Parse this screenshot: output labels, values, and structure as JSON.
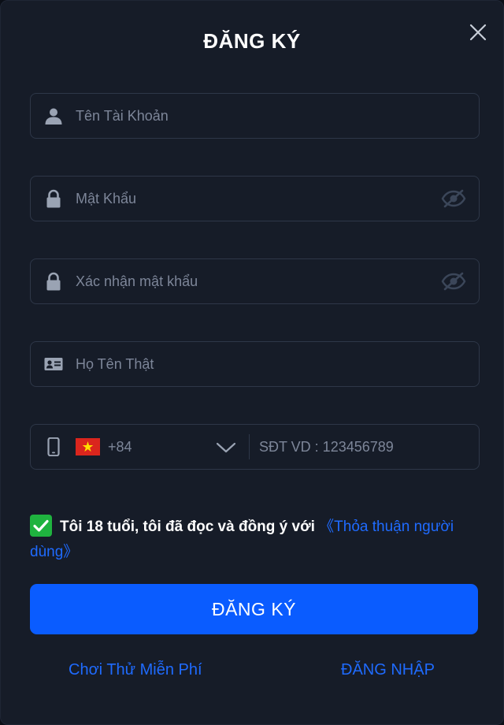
{
  "modal": {
    "title": "ĐĂNG KÝ"
  },
  "form": {
    "username": {
      "placeholder": "Tên Tài Khoản",
      "value": ""
    },
    "password": {
      "placeholder": "Mật Khẩu",
      "value": ""
    },
    "confirm_password": {
      "placeholder": "Xác nhận mật khẩu",
      "value": ""
    },
    "real_name": {
      "placeholder": "Họ Tên Thật",
      "value": ""
    },
    "phone": {
      "country_code": "+84",
      "placeholder": "SĐT VD : 123456789",
      "value": ""
    }
  },
  "agreement": {
    "checked": true,
    "text": "Tôi 18 tuổi, tôi đã đọc và đồng ý với",
    "link": "《Thỏa thuận người dùng》"
  },
  "actions": {
    "submit_label": "ĐĂNG KÝ",
    "free_trial_label": "Chơi Thử Miễn Phí",
    "login_label": "ĐĂNG NHẬP"
  },
  "colors": {
    "background": "#161c28",
    "primary": "#0a5cff",
    "link": "#1f6bff",
    "check": "#1fb33f",
    "placeholder": "#7d8699"
  }
}
